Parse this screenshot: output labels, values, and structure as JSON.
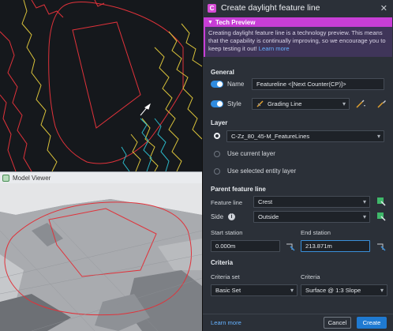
{
  "viewport": {
    "model_viewer_label": "Model Viewer"
  },
  "dialog": {
    "app_icon": "C",
    "title": "Create daylight feature line",
    "close_icon": "close-icon",
    "tech_preview": {
      "label": "Tech Preview",
      "message": "Creating daylight feature line is a technology preview. This means that the capability is continually improving, so we encourage you to keep testing it out!",
      "link": "Learn more"
    },
    "general": {
      "title": "General",
      "name_label": "Name",
      "name_value": "Featureline <[Next Counter(CP)]>",
      "style_label": "Style",
      "style_value": "Grading Line"
    },
    "layer": {
      "title": "Layer",
      "options": [
        "C-Zz_80_45-M_FeatureLines",
        "Use current layer",
        "Use selected entity layer"
      ],
      "selected_index": 0
    },
    "parent": {
      "title": "Parent feature line",
      "feature_line_label": "Feature line",
      "feature_line_value": "Crest",
      "side_label": "Side",
      "side_value": "Outside",
      "start_label": "Start station",
      "start_value": "0.000m",
      "end_label": "End station",
      "end_value": "213.871m"
    },
    "criteria": {
      "title": "Criteria",
      "set_label": "Criteria set",
      "set_value": "Basic Set",
      "criteria_label": "Criteria",
      "criteria_value": "Surface @ 1:3 Slope"
    },
    "footer": {
      "learn_more": "Learn more",
      "cancel": "Cancel",
      "create": "Create"
    }
  },
  "colors": {
    "accent": "#1f7ad1",
    "preview": "#c83ed6",
    "contour_red": "#e0323a",
    "contour_yellow": "#d9c23a",
    "contour_cyan": "#2bb7c7"
  }
}
